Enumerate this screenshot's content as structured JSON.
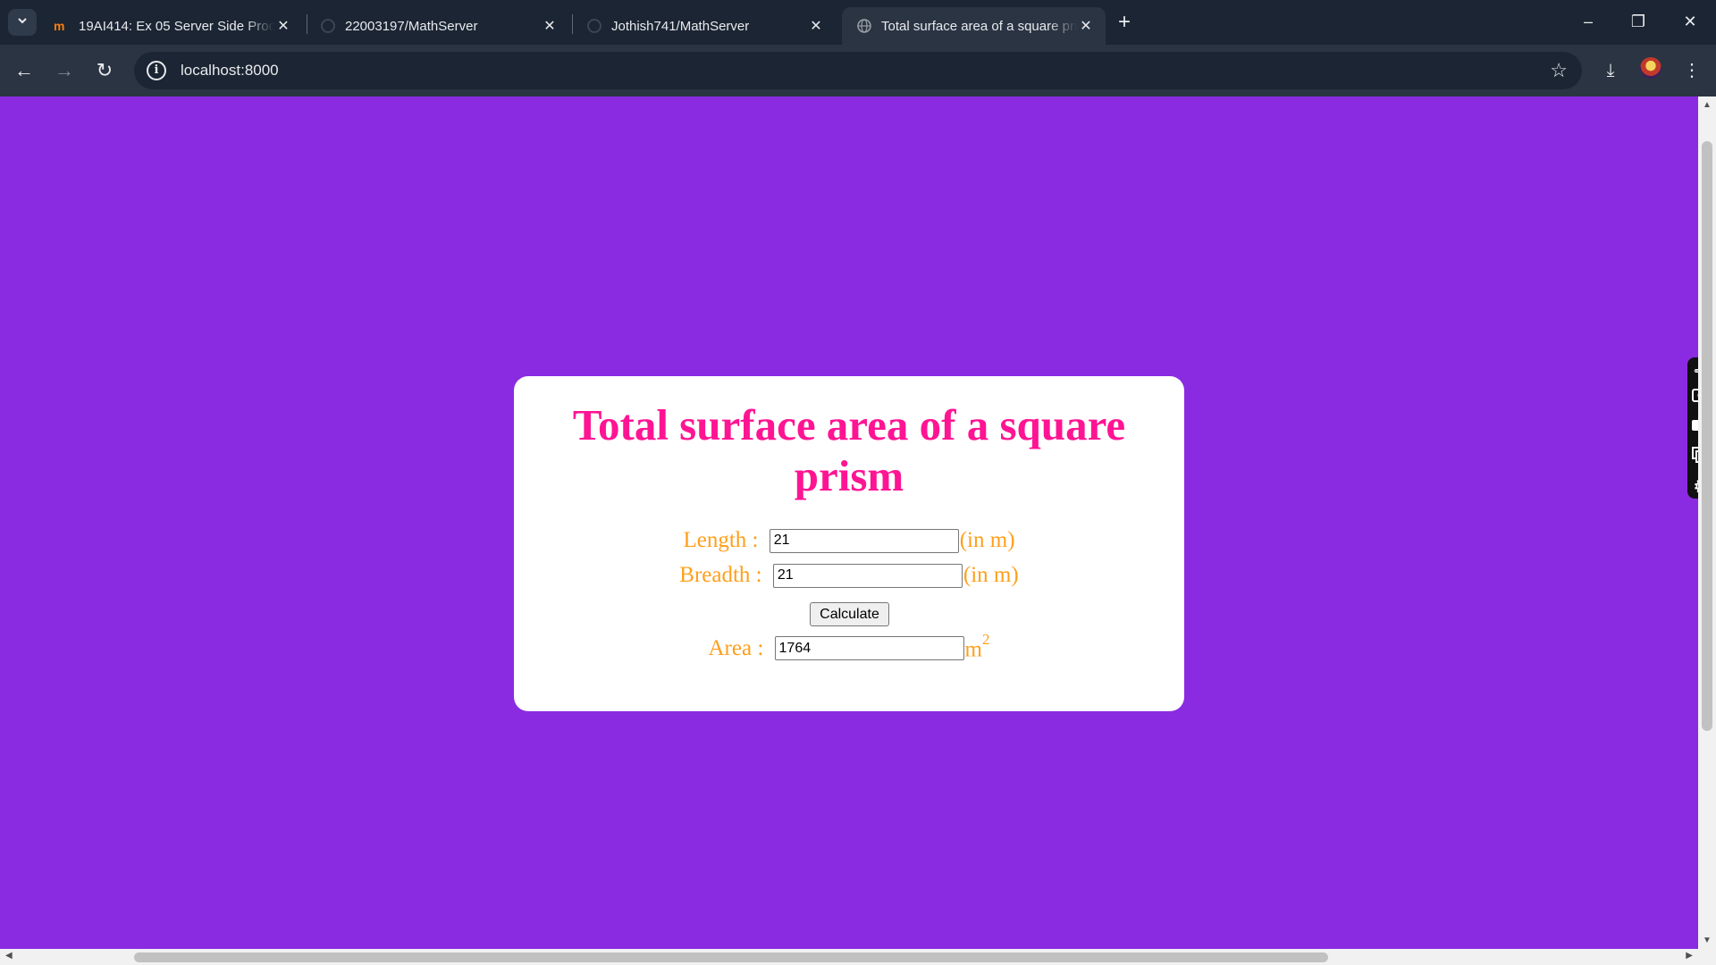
{
  "browser": {
    "tabs": [
      {
        "title": "19AI414: Ex 05 Server Side Proc",
        "favicon": "moodle-icon",
        "active": false
      },
      {
        "title": "22003197/MathServer",
        "favicon": "github-icon",
        "active": false
      },
      {
        "title": "Jothish741/MathServer",
        "favicon": "github-icon",
        "active": false
      },
      {
        "title": "Total surface area of a square prism",
        "favicon": "globe-icon",
        "active": true
      }
    ],
    "url": "localhost:8000"
  },
  "page": {
    "heading": "Total surface area of a square prism",
    "length": {
      "label": "Length : ",
      "value": "21",
      "unit": "(in m)"
    },
    "breadth": {
      "label": "Breadth : ",
      "value": "21",
      "unit": "(in m)"
    },
    "calculate_label": "Calculate",
    "area": {
      "label": "Area : ",
      "value": "1764",
      "unit": "m",
      "unit_sup": "2"
    }
  },
  "colors": {
    "background": "#8a2be2",
    "heading": "#ff1493",
    "labels": "#ff9f1a",
    "card": "#ffffff"
  }
}
